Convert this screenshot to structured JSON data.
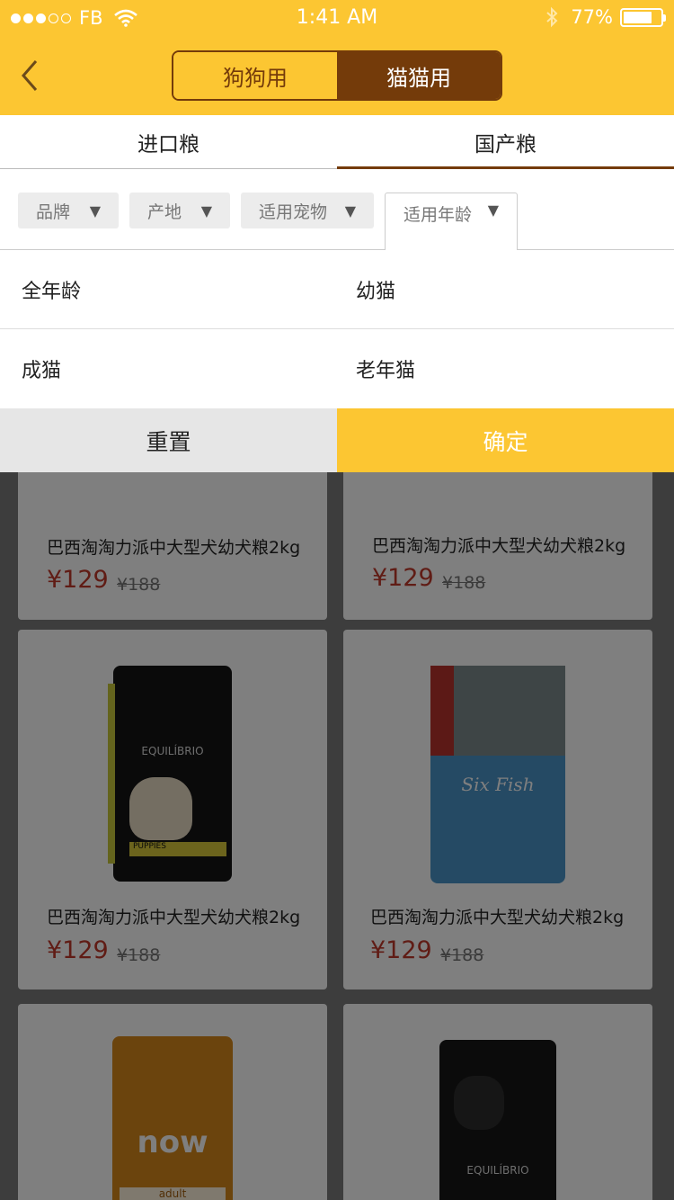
{
  "status_bar": {
    "carrier": "FB",
    "time": "1:41 AM",
    "battery": "77%"
  },
  "header": {
    "segments": [
      "狗狗用",
      "猫猫用"
    ],
    "selected_segment": "猫猫用"
  },
  "tabs": [
    "进口粮",
    "国产粮"
  ],
  "selected_tab": "国产粮",
  "filters": [
    {
      "label": "品牌"
    },
    {
      "label": "产地"
    },
    {
      "label": "适用宠物"
    },
    {
      "label": "适用年龄"
    }
  ],
  "active_filter": "适用年龄",
  "age_options": [
    "全年龄",
    "幼猫",
    "成猫",
    "老年猫"
  ],
  "actions": {
    "reset": "重置",
    "confirm": "确定"
  },
  "products": [
    {
      "name": "巴西淘淘力派中大型犬幼犬粮2kg",
      "price": "¥129",
      "old_price": "¥188"
    },
    {
      "name": "巴西淘淘力派中大型犬幼犬粮2kg",
      "price": "¥129",
      "old_price": "¥188"
    },
    {
      "name": "巴西淘淘力派中大型犬幼犬粮2kg",
      "price": "¥129",
      "old_price": "¥188"
    },
    {
      "name": "巴西淘淘力派中大型犬幼犬粮2kg",
      "price": "¥129",
      "old_price": "¥188"
    },
    {
      "name": "",
      "price": "",
      "old_price": ""
    },
    {
      "name": "",
      "price": "",
      "old_price": ""
    }
  ],
  "package_texts": {
    "equilibrio": "EQUILÍBRIO",
    "puppies": "PUPPIES",
    "six_fish": "Six Fish",
    "now": "now",
    "adult": "adult"
  },
  "colors": {
    "brand_yellow": "#fcc632",
    "brand_brown": "#743b0a",
    "price_red": "#c0392b"
  }
}
